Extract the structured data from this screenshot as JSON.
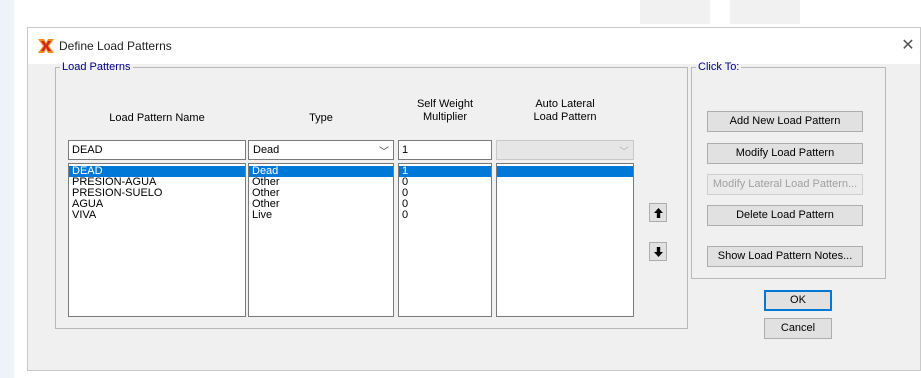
{
  "window": {
    "title": "Define Load Patterns"
  },
  "load_patterns_group": {
    "legend": "Load Patterns",
    "headers": {
      "name": "Load Pattern Name",
      "type": "Type",
      "self_weight_line1": "Self Weight",
      "self_weight_line2": "Multiplier",
      "auto_lateral_line1": "Auto Lateral",
      "auto_lateral_line2": "Load Pattern"
    },
    "editor": {
      "name": "DEAD",
      "type": "Dead",
      "self_weight": "1",
      "auto_lateral": ""
    },
    "rows": [
      {
        "name": "DEAD",
        "type": "Dead",
        "self_weight": "1"
      },
      {
        "name": "PRESION-AGUA",
        "type": "Other",
        "self_weight": "0"
      },
      {
        "name": "PRESION-SUELO",
        "type": "Other",
        "self_weight": "0"
      },
      {
        "name": "AGUA",
        "type": "Other",
        "self_weight": "0"
      },
      {
        "name": "VIVA",
        "type": "Live",
        "self_weight": "0"
      }
    ]
  },
  "click_to": {
    "legend": "Click To:",
    "add": "Add New Load Pattern",
    "modify": "Modify Load Pattern",
    "modify_lateral": "Modify Lateral Load Pattern...",
    "delete": "Delete Load Pattern",
    "notes": "Show Load Pattern Notes..."
  },
  "dialog": {
    "ok": "OK",
    "cancel": "Cancel"
  },
  "icons": {
    "app": "define-load-patterns-icon",
    "close": "close-icon",
    "move_up": "arrow-up-icon",
    "move_down": "arrow-down-icon",
    "dropdown": "chevron-down-icon"
  },
  "colors": {
    "selection": "#0078d7",
    "legend_text": "#000080",
    "icon_orange": "#f08a1c",
    "icon_red": "#d21f1f"
  }
}
